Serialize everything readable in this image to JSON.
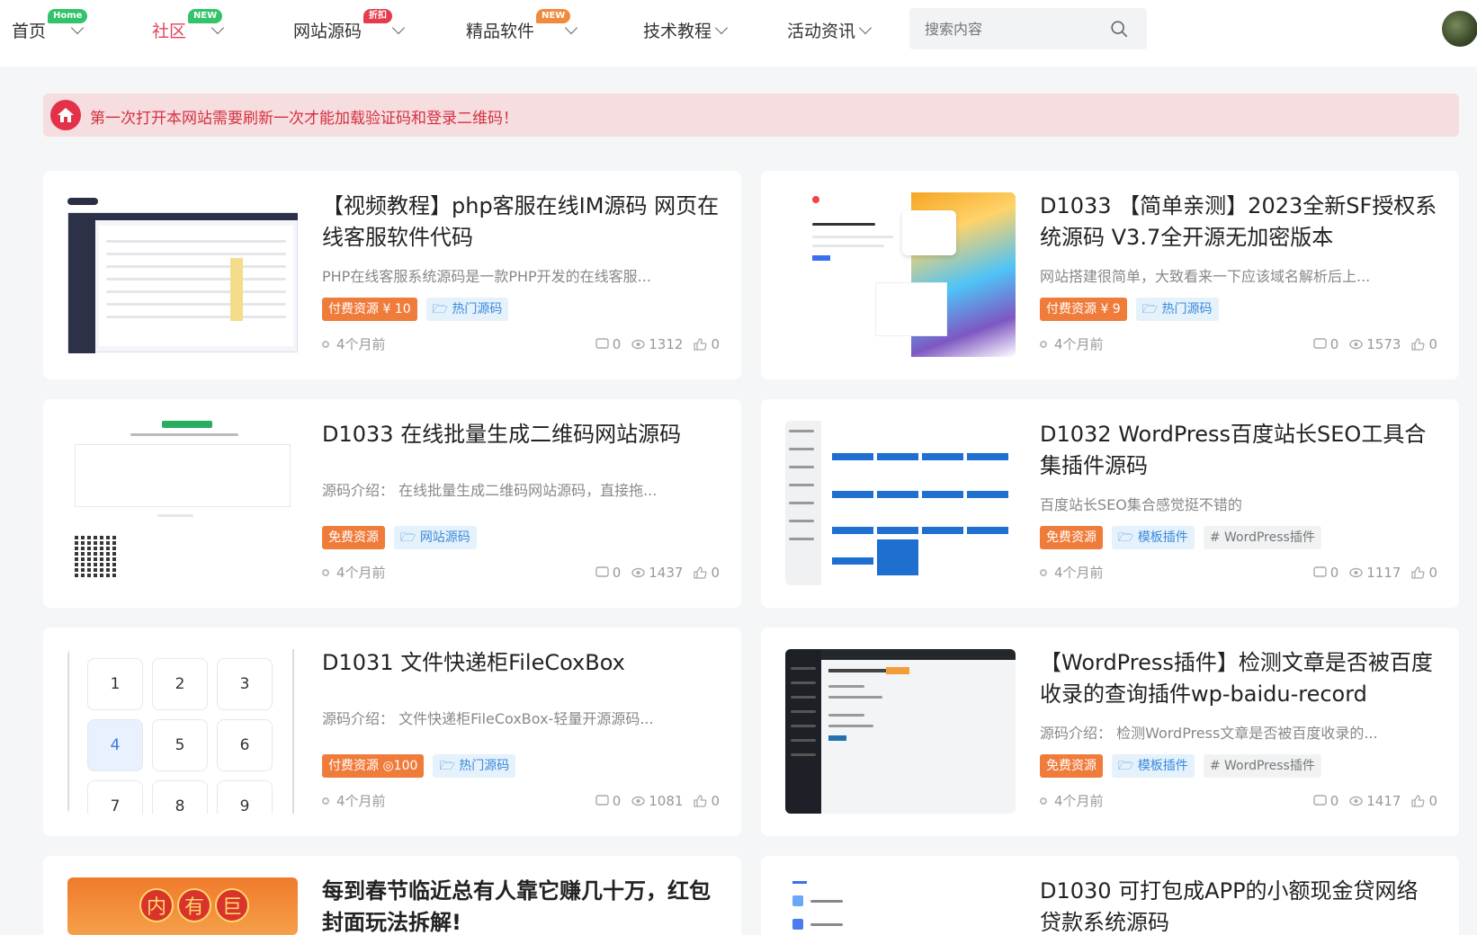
{
  "nav": {
    "items": [
      {
        "label": "首页",
        "badge": "Home",
        "badge_color": "#33c36a"
      },
      {
        "label": "社区",
        "badge": "NEW",
        "badge_color": "#33c36a",
        "active": true
      },
      {
        "label": "网站源码",
        "badge": "折扣",
        "badge_color": "#e53c4d"
      },
      {
        "label": "精品软件",
        "badge": "NEW",
        "badge_color": "#f08a3c"
      },
      {
        "label": "技术教程",
        "badge": ""
      },
      {
        "label": "活动资讯",
        "badge": ""
      }
    ],
    "search_placeholder": "搜索内容"
  },
  "notice": {
    "text": "第一次打开本网站需要刷新一次才能加载验证码和登录二维码！"
  },
  "cards": [
    {
      "title": "【视频教程】php客服在线IM源码 网页在线客服软件代码",
      "desc": "PHP在线客服系统源码是一款PHP开发的在线客服...",
      "tags": [
        {
          "text": "付费资源 ¥ 10",
          "kind": "pay"
        },
        {
          "text": "热门源码",
          "kind": "cat"
        }
      ],
      "time": "4个月前",
      "comments": "0",
      "views": "1312",
      "likes": "0"
    },
    {
      "title": "D1033 【简单亲测】2023全新SF授权系统源码 V3.7全开源无加密版本",
      "desc": "网站搭建很简单，大致看来一下应该域名解析后上...",
      "tags": [
        {
          "text": "付费资源 ¥ 9",
          "kind": "pay"
        },
        {
          "text": "热门源码",
          "kind": "cat"
        }
      ],
      "time": "4个月前",
      "comments": "0",
      "views": "1573",
      "likes": "0"
    },
    {
      "title": "D1033 在线批量生成二维码网站源码",
      "desc": "源码介绍： 在线批量生成二维码网站源码，直接拖...",
      "tags": [
        {
          "text": "免费资源",
          "kind": "pay"
        },
        {
          "text": "网站源码",
          "kind": "cat"
        }
      ],
      "time": "4个月前",
      "comments": "0",
      "views": "1437",
      "likes": "0"
    },
    {
      "title": "D1032 WordPress百度站长SEO工具合集插件源码",
      "desc": "百度站长SEO集合感觉挺不错的",
      "tags": [
        {
          "text": "免费资源",
          "kind": "pay"
        },
        {
          "text": "模板插件",
          "kind": "cat"
        },
        {
          "text": "# WordPress插件",
          "kind": "kw"
        }
      ],
      "time": "4个月前",
      "comments": "0",
      "views": "1117",
      "likes": "0"
    },
    {
      "title": "D1031 文件快递柜FileCoxBox",
      "desc": "源码介绍： 文件快递柜FileCoxBox-轻量开源源码...",
      "tags": [
        {
          "text": "付费资源 ◎100",
          "kind": "pay"
        },
        {
          "text": "热门源码",
          "kind": "cat"
        }
      ],
      "time": "4个月前",
      "comments": "0",
      "views": "1081",
      "likes": "0"
    },
    {
      "title": "【WordPress插件】检测文章是否被百度收录的查询插件wp-baidu-record",
      "desc": "源码介绍： 检测WordPress文章是否被百度收录的...",
      "tags": [
        {
          "text": "免费资源",
          "kind": "pay"
        },
        {
          "text": "模板插件",
          "kind": "cat"
        },
        {
          "text": "# WordPress插件",
          "kind": "kw"
        }
      ],
      "time": "4个月前",
      "comments": "0",
      "views": "1417",
      "likes": "0"
    },
    {
      "title": "每到春节临近总有人靠它赚几十万，红包封面玩法拆解!",
      "desc": "",
      "tags": [],
      "time": "",
      "comments": "",
      "views": "",
      "likes": ""
    },
    {
      "title": "D1030 可打包成APP的小额现金贷网络贷款系统源码",
      "desc": "",
      "tags": [],
      "time": "",
      "comments": "",
      "views": "",
      "likes": ""
    }
  ],
  "thumbs": {
    "numpad": [
      "1",
      "2",
      "3",
      "4",
      "5",
      "6",
      "7",
      "8",
      "9"
    ],
    "hongbao": [
      "内",
      "有",
      "巨"
    ]
  }
}
